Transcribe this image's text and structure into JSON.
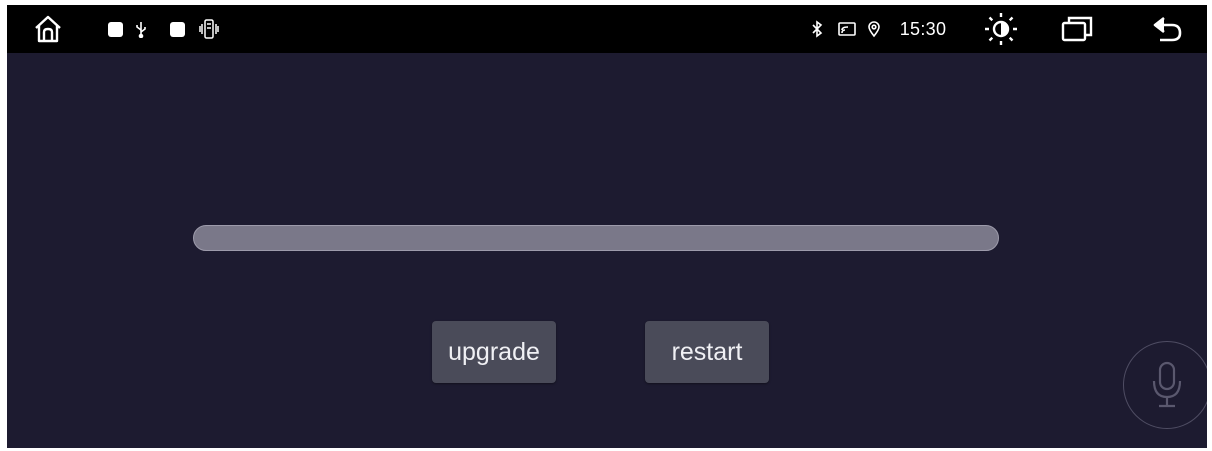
{
  "status_bar": {
    "left_icons": [
      "home-icon",
      "notification-square-icon",
      "usb-icon",
      "notification-square-icon",
      "vibrate-icon"
    ],
    "right_icons": [
      "bluetooth-icon",
      "cast-icon",
      "location-icon"
    ],
    "time": "15:30",
    "buttons": [
      "brightness-icon",
      "recent-apps-icon",
      "back-icon"
    ]
  },
  "upgrade": {
    "progress_percent": 0,
    "upgrade_label": "upgrade",
    "restart_label": "restart"
  },
  "voice": {
    "icon": "microphone-icon"
  },
  "colors": {
    "background": "#1d1b30",
    "status_bar": "#000000",
    "progress_track": "#7a7889",
    "button": "#4a4b59",
    "button_text": "#f0f0f4"
  }
}
